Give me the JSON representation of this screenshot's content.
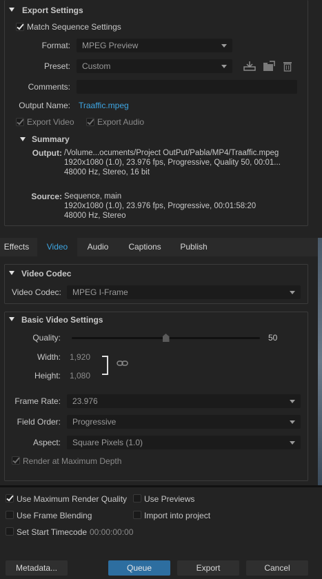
{
  "export_settings": {
    "title": "Export Settings",
    "match_sequence": {
      "label": "Match Sequence Settings",
      "checked": true
    },
    "format": {
      "label": "Format:",
      "value": "MPEG Preview"
    },
    "preset": {
      "label": "Preset:",
      "value": "Custom"
    },
    "comments": {
      "label": "Comments:",
      "value": ""
    },
    "output_name": {
      "label": "Output Name:",
      "value": "Traaffic.mpeg",
      "color": "#3ea6e3"
    },
    "export_video": {
      "label": "Export Video",
      "checked": true
    },
    "export_audio": {
      "label": "Export Audio",
      "checked": true
    },
    "summary": {
      "title": "Summary",
      "output_label": "Output:",
      "output_lines": [
        "/Volume...ocuments/Project OutPut/Pabla/MP4/Traaffic.mpeg",
        "1920x1080 (1.0), 23.976 fps, Progressive, Quality 50, 00:01...",
        "48000 Hz, Stereo, 16 bit"
      ],
      "source_label": "Source:",
      "source_lines": [
        "Sequence, main",
        "1920x1080 (1.0), 23.976 fps, Progressive, 00:01:58:20",
        "48000 Hz, Stereo"
      ]
    }
  },
  "tabs": [
    {
      "label": "Effects",
      "active": false
    },
    {
      "label": "Video",
      "active": true
    },
    {
      "label": "Audio",
      "active": false
    },
    {
      "label": "Captions",
      "active": false
    },
    {
      "label": "Publish",
      "active": false
    }
  ],
  "video_codec": {
    "title": "Video Codec",
    "codec": {
      "label": "Video Codec:",
      "value": "MPEG I-Frame"
    }
  },
  "basic_video": {
    "title": "Basic Video Settings",
    "quality": {
      "label": "Quality:",
      "value": "50",
      "fraction": 0.5
    },
    "width": {
      "label": "Width:",
      "value": "1,920"
    },
    "height": {
      "label": "Height:",
      "value": "1,080"
    },
    "frame_rate": {
      "label": "Frame Rate:",
      "value": "23.976"
    },
    "field_order": {
      "label": "Field Order:",
      "value": "Progressive"
    },
    "aspect": {
      "label": "Aspect:",
      "value": "Square Pixels (1.0)"
    },
    "render_max_depth": {
      "label": "Render at Maximum Depth",
      "checked": true
    }
  },
  "options": {
    "max_render_quality": {
      "label": "Use Maximum Render Quality",
      "checked": true
    },
    "use_previews": {
      "label": "Use Previews",
      "checked": false
    },
    "frame_blending": {
      "label": "Use Frame Blending",
      "checked": false
    },
    "import_project": {
      "label": "Import into project",
      "checked": false
    },
    "start_timecode": {
      "label": "Set Start Timecode",
      "value": "00:00:00:00",
      "checked": false
    }
  },
  "buttons": {
    "metadata": "Metadata...",
    "queue": "Queue",
    "export": "Export",
    "cancel": "Cancel"
  },
  "colors": {
    "accent": "#3ea6e3",
    "primary_button": "#2d6ea0"
  }
}
